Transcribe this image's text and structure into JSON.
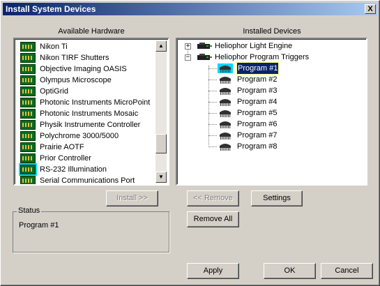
{
  "window": {
    "title": "Install System Devices",
    "close_label": "X"
  },
  "available": {
    "heading": "Available Hardware",
    "items": [
      "Nikon Ti",
      "Nikon TIRF Shutters",
      "Objective Imaging OASIS",
      "Olympus Microscope",
      "OptiGrid",
      "Photonic Instruments MicroPoint",
      "Photonic Instruments Mosaic",
      "Physik Instrumente Controller",
      "Polychrome 3000/5000",
      "Prairie AOTF",
      "Prior Controller",
      "RS-232 Illumination",
      "Serial Communications Port"
    ],
    "selected_index": 11
  },
  "installed": {
    "heading": "Installed Devices",
    "devices": [
      {
        "label": "Heliophor Light Engine",
        "expander": "+"
      },
      {
        "label": "Heliophor Program Triggers",
        "expander": "−"
      }
    ],
    "programs": [
      "Program #1",
      "Program #2",
      "Program #3",
      "Program #4",
      "Program #5",
      "Program #6",
      "Program #7",
      "Program #8"
    ],
    "selected_program": "Program #1"
  },
  "buttons": {
    "install": "Install >>",
    "remove": "<< Remove",
    "settings": "Settings",
    "remove_all": "Remove All",
    "apply": "Apply",
    "ok": "OK",
    "cancel": "Cancel"
  },
  "status": {
    "legend": "Status",
    "text": "Program #1"
  },
  "colors": {
    "title_start": "#0a246a",
    "title_end": "#a6caf0",
    "selection": "#0a246a"
  }
}
